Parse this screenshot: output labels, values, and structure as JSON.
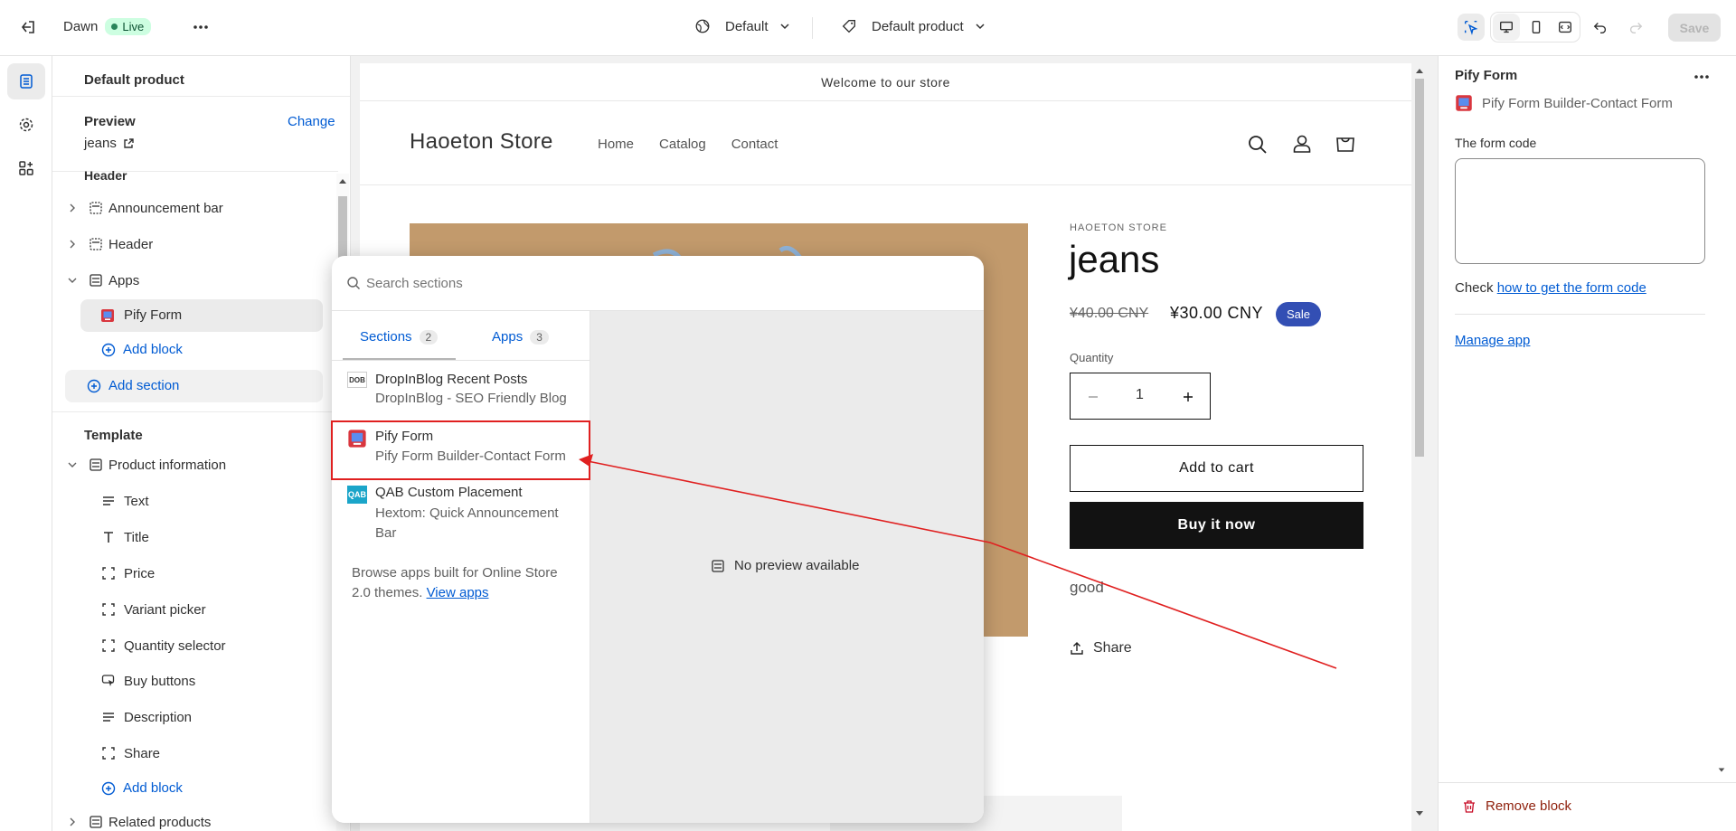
{
  "topbar": {
    "theme_name": "Dawn",
    "live_label": "Live",
    "template_label": "Default",
    "product_label": "Default product",
    "save_label": "Save"
  },
  "left_panel": {
    "title": "Default product",
    "preview_label": "Preview",
    "change_label": "Change",
    "preview_item": "jeans",
    "header_group": "Header",
    "header_items": [
      {
        "label": "Announcement bar"
      },
      {
        "label": "Header"
      },
      {
        "label": "Apps"
      }
    ],
    "apps_child": "Pify Form",
    "add_block": "Add block",
    "add_section": "Add section",
    "template_group": "Template",
    "product_information": "Product information",
    "blocks": [
      {
        "label": "Text"
      },
      {
        "label": "Title"
      },
      {
        "label": "Price"
      },
      {
        "label": "Variant picker"
      },
      {
        "label": "Quantity selector"
      },
      {
        "label": "Buy buttons"
      },
      {
        "label": "Description"
      },
      {
        "label": "Share"
      }
    ],
    "add_block_2": "Add block",
    "related_products": "Related products"
  },
  "preview": {
    "announcement": "Welcome to our store",
    "store_name": "Haoeton Store",
    "nav": [
      "Home",
      "Catalog",
      "Contact"
    ],
    "vendor": "HAOETON STORE",
    "product_title": "jeans",
    "compare_price": "¥40.00 CNY",
    "price": "¥30.00 CNY",
    "sale_badge": "Sale",
    "quantity_label": "Quantity",
    "quantity_value": "1",
    "add_to_cart": "Add to cart",
    "buy_now": "Buy it now",
    "description": "good",
    "share": "Share"
  },
  "popup": {
    "search_placeholder": "Search sections",
    "tabs": [
      {
        "label": "Sections",
        "count": "2"
      },
      {
        "label": "Apps",
        "count": "3"
      }
    ],
    "items": [
      {
        "title": "DropInBlog Recent Posts",
        "subtitle": "DropInBlog - SEO Friendly Blog",
        "icon_text": "DOB"
      },
      {
        "title": "Pify Form",
        "subtitle": "Pify Form Builder-Contact Form",
        "icon_text": ""
      },
      {
        "title": "QAB Custom Placement",
        "subtitle": "Hextom: Quick Announcement Bar",
        "icon_text": "QAB"
      }
    ],
    "browse_text": "Browse apps built for Online Store 2.0 themes.",
    "view_apps": "View apps",
    "no_preview": "No preview available"
  },
  "right_panel": {
    "title": "Pify Form",
    "app_name": "Pify Form Builder-Contact Form",
    "form_code_label": "The form code",
    "form_code_value": "",
    "check_prefix": "Check",
    "check_link": "how to get the form code",
    "manage_app": "Manage app",
    "remove_block": "Remove block"
  },
  "colors": {
    "accent_blue": "#005bd3",
    "highlight_red": "#e02020",
    "sale_badge": "#334fb4",
    "buy_now_bg": "#121212"
  }
}
